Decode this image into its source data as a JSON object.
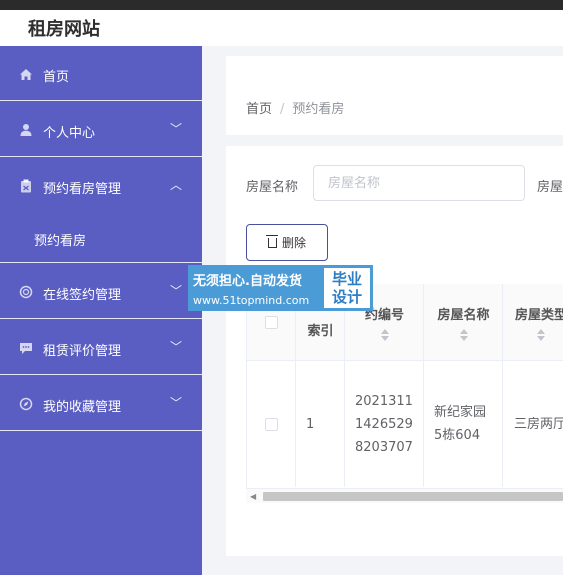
{
  "site": {
    "title": "租房网站"
  },
  "sidebar": {
    "items": [
      {
        "label": "首页",
        "icon": "home-icon"
      },
      {
        "label": "个人中心",
        "icon": "user-icon",
        "chevron": "﹀"
      },
      {
        "label": "预约看房管理",
        "icon": "clipboard-icon",
        "chevron": "︿"
      },
      {
        "label": "在线签约管理",
        "icon": "circle-icon",
        "chevron": "﹀"
      },
      {
        "label": "租赁评价管理",
        "icon": "chat-icon",
        "chevron": "﹀"
      },
      {
        "label": "我的收藏管理",
        "icon": "compass-icon",
        "chevron": "﹀"
      }
    ],
    "subitem": {
      "label": "预约看房"
    }
  },
  "breadcrumb": {
    "home": "首页",
    "separator": "/",
    "current": "预约看房"
  },
  "search": {
    "label": "房屋名称",
    "placeholder": "房屋名称",
    "label2": "房屋"
  },
  "toolbar": {
    "delete_label": "删除"
  },
  "table": {
    "headers": {
      "index": "索引",
      "appointment_no": "约编号",
      "house_name": "房屋名称",
      "house_type": "房屋类型"
    },
    "rows": [
      {
        "index": "1",
        "appointment_no": [
          "2021311",
          "1426529",
          "8203707"
        ],
        "house_name": [
          "新纪家园",
          "5栋604"
        ],
        "house_type": "三房两厅"
      }
    ]
  },
  "watermark": {
    "line1": "无须担心.自动发货",
    "line2": "www.51topmind.com",
    "badge_top": "毕业",
    "badge_bottom": "设计"
  },
  "colors": {
    "sidebar": "#5a5ec2",
    "accent": "#4b4f9f",
    "watermark": "#4a9bd6"
  }
}
